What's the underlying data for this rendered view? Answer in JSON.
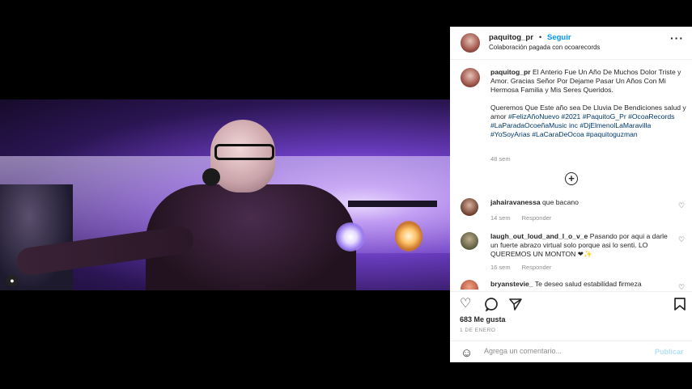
{
  "post": {
    "username": "paquitog_pr",
    "separator": "•",
    "follow_label": "Seguir",
    "subtitle": "Colaboración pagada con ocoarecords",
    "more_icon": "more-horizontal-icon"
  },
  "caption": {
    "username": "paquitog_pr",
    "text_1": "El Anterio Fue Un Año De Muchos Dolor Triste y Amor. Gracias Señor Por Dejame Pasar Un Años Con Mi Hermosa Familia y Mis Seres Queridos.",
    "text_2": "Queremos Que Este año sea De Lluvia De Bendiciones salud y amor",
    "hashtags": "#FelizAñoNuevo #2021 #PaquitoG_Pr #OcoaRecords #LaParadaOcoeñaMusic inc #DjElmenolLaMaravilla #YoSoyArias #LaCaraDeOcoa #paquitoguzman",
    "time": "48 sem"
  },
  "comments": [
    {
      "username": "jahairavanessa",
      "text": "que bacano",
      "time": "14 sem",
      "reply_label": "Responder"
    },
    {
      "username": "laugh_out_loud_and_l_o_v_e",
      "text": "Pasando por aqui a darle un fuerte abrazo virtual solo porque asi lo senti. LO QUEREMOS UN MONTON ❤✨",
      "time": "16 sem",
      "reply_label": "Responder"
    },
    {
      "username": "bryanstevie_",
      "text": "Te deseo salud estabilidad firmeza"
    }
  ],
  "actions": {
    "like_icon": "heart-icon",
    "comment_icon": "comment-icon",
    "share_icon": "send-icon",
    "save_icon": "bookmark-icon"
  },
  "likes": "683 Me gusta",
  "date": "1 DE ENERO",
  "add_comment": {
    "placeholder": "Agrega un comentario...",
    "post_label": "Publicar"
  },
  "colors": {
    "link_blue": "#0095f6",
    "hashtag_blue": "#00376b",
    "muted": "#8e8e8e",
    "text": "#262626"
  }
}
